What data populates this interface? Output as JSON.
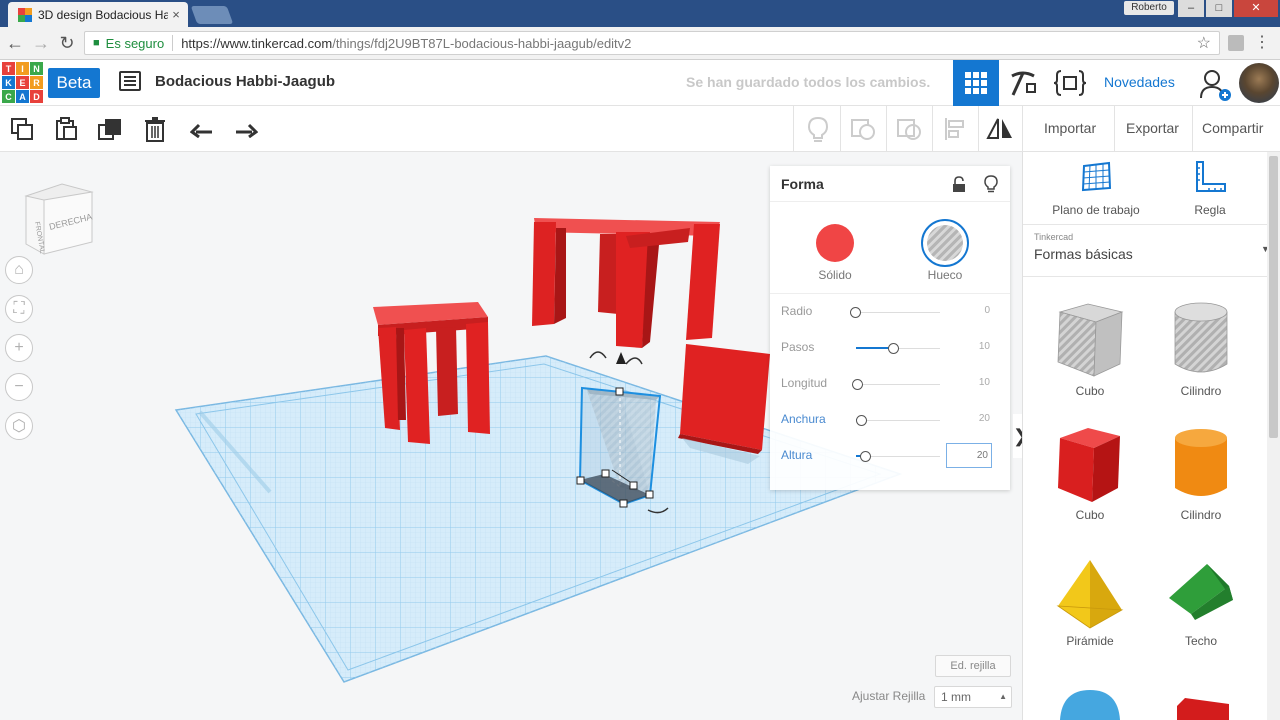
{
  "browser": {
    "tab_title": "3D design Bodacious Ha",
    "tab_close": "×",
    "user_chip": "Roberto",
    "url_secure_label": "Es seguro",
    "url_host": "https://www.tinkercad.com",
    "url_path": "/things/fdj2U9BT87L-bodacious-habbi-jaagub/editv2",
    "win_minimize": "–",
    "win_maximize": "□",
    "win_close": "✕"
  },
  "header": {
    "logo_letters": [
      "TIN",
      "KER",
      "CAD"
    ],
    "beta_label": "Beta",
    "design_title": "Bodacious Habbi-Jaagub",
    "save_status": "Se han guardado todos los cambios.",
    "novedades_label": "Novedades"
  },
  "toolbar": {
    "import_label": "Importar",
    "export_label": "Exportar",
    "share_label": "Compartir"
  },
  "viewcube": {
    "face_front": "FRONTAL",
    "face_right": "DERECHA"
  },
  "shape_panel": {
    "title": "Forma",
    "solid_label": "Sólido",
    "hole_label": "Hueco",
    "params": [
      {
        "label": "Radio",
        "value": "0",
        "fraction": 0.0
      },
      {
        "label": "Pasos",
        "value": "10",
        "fraction": 0.45
      },
      {
        "label": "Longitud",
        "value": "10",
        "fraction": 0.02
      },
      {
        "label": "Anchura",
        "value": "20",
        "fraction": 0.07
      },
      {
        "label": "Altura",
        "value": "20",
        "fraction": 0.12
      }
    ]
  },
  "workplane": {
    "edit_grid_label": "Ed. rejilla",
    "snap_grid_label": "Ajustar Rejilla",
    "snap_grid_value": "1 mm"
  },
  "library": {
    "workplane_label": "Plano de trabajo",
    "ruler_label": "Regla",
    "source": "Tinkercad",
    "category": "Formas básicas",
    "shapes": [
      {
        "label": "Cubo",
        "icon": "hole-box-icon"
      },
      {
        "label": "Cilindro",
        "icon": "hole-cylinder-icon"
      },
      {
        "label": "Cubo",
        "icon": "red-box-icon"
      },
      {
        "label": "Cilindro",
        "icon": "orange-cylinder-icon"
      },
      {
        "label": "Pirámide",
        "icon": "pyramid-icon"
      },
      {
        "label": "Techo",
        "icon": "roof-icon"
      }
    ]
  },
  "colors": {
    "brand_blue": "#1477d1",
    "object_red": "#e02222",
    "grid_blue": "#a8d4ef",
    "hole_gray": "#b5b5b5"
  }
}
